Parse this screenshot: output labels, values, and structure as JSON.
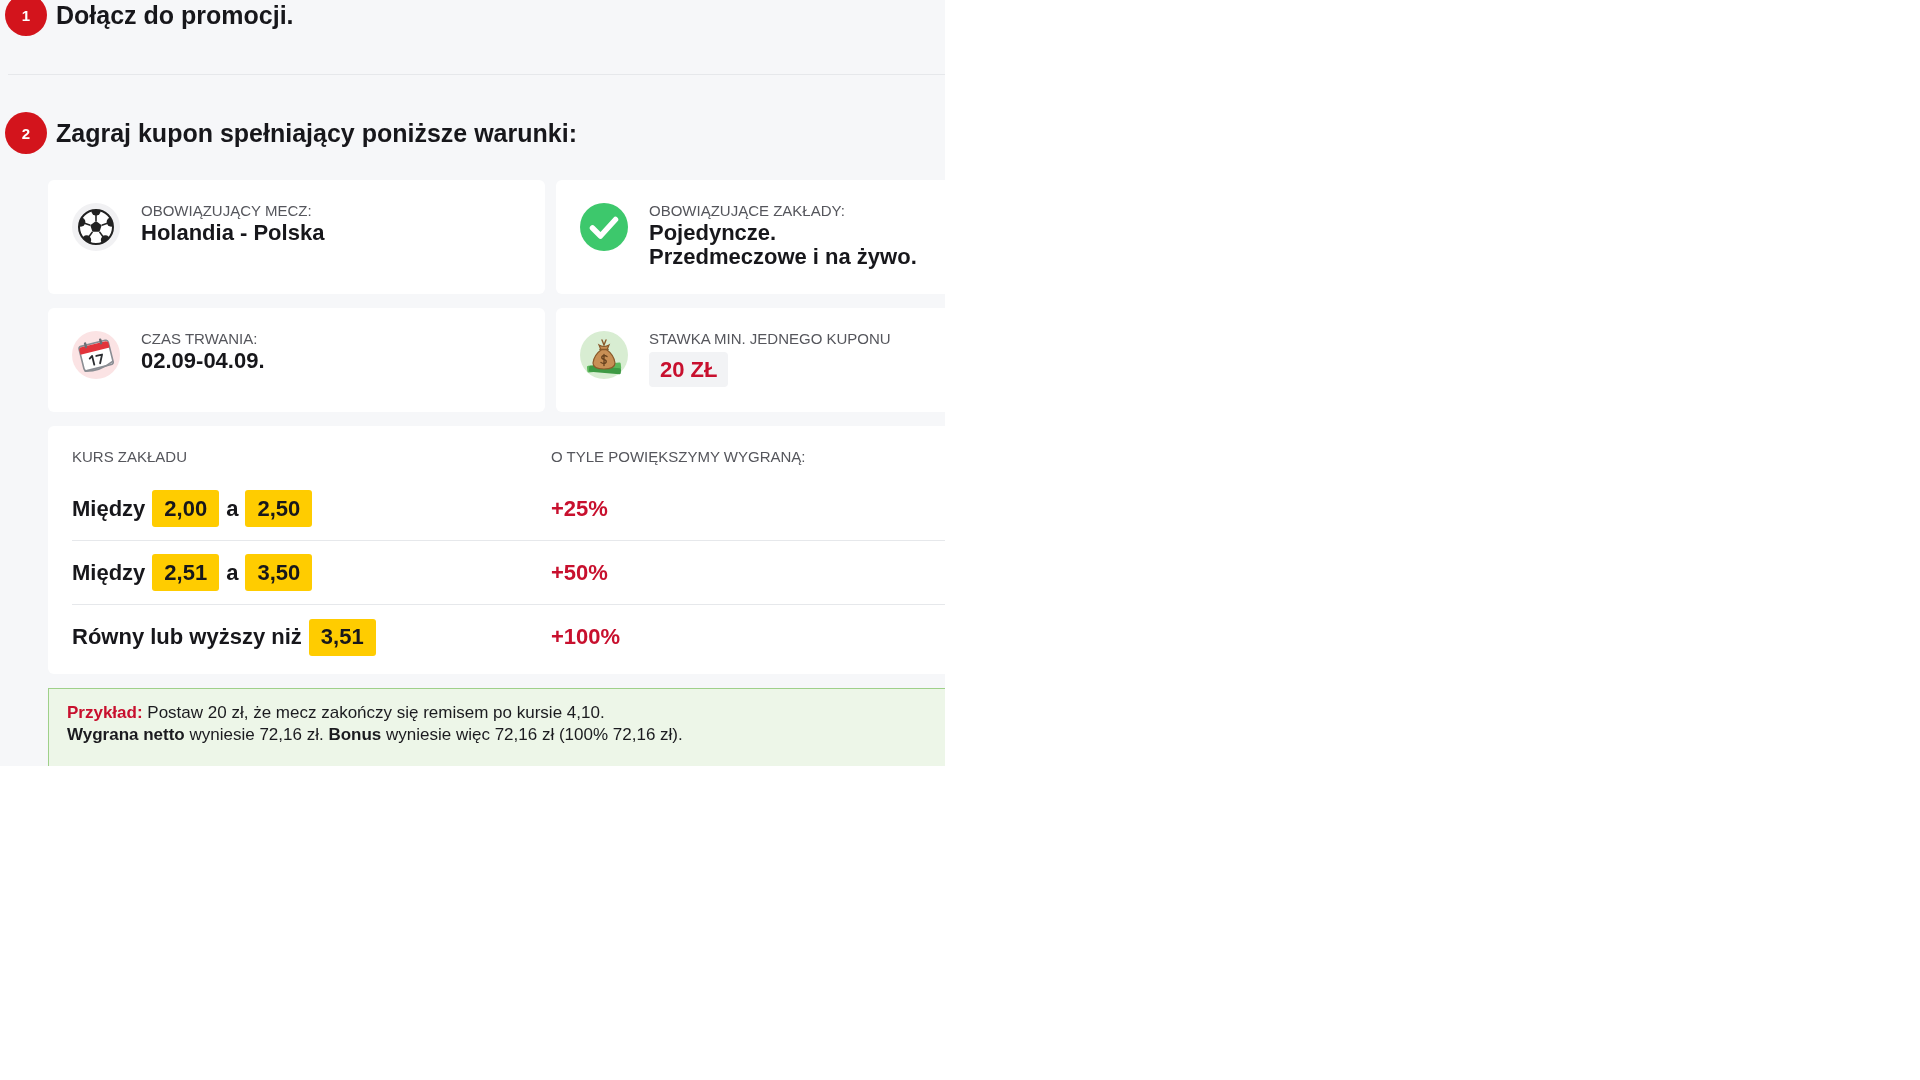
{
  "steps": [
    {
      "number": "1",
      "title": "Dołącz do promocji."
    },
    {
      "number": "2",
      "title": "Zagraj kupon spełniający poniższe warunki:"
    }
  ],
  "conditions": [
    {
      "kind": "ball",
      "label": "OBOWIĄZUJĄCY MECZ:",
      "lines": [
        "Holandia - Polska"
      ]
    },
    {
      "kind": "check",
      "label": "OBOWIĄZUJĄCE ZAKŁADY:",
      "lines": [
        "Pojedyncze.",
        "Przedmeczowe i na żywo."
      ]
    },
    {
      "kind": "calendar",
      "label": "CZAS TRWANIA:",
      "lines": [
        "02.09-04.09."
      ]
    },
    {
      "kind": "money",
      "label": "STAWKA MIN. JEDNEGO KUPONU",
      "amount": "20 ZŁ"
    }
  ],
  "odds_table": {
    "columns": [
      "KURS ZAKŁADU",
      "O TYLE POWIĘKSZYMY WYGRANĄ:"
    ],
    "rows": [
      {
        "range": [
          {
            "kind": "text",
            "text": "Między"
          },
          {
            "kind": "chip",
            "text": "2,00"
          },
          {
            "kind": "text",
            "text": "a"
          },
          {
            "kind": "chip",
            "text": "2,50"
          }
        ],
        "bonus": "+25%"
      },
      {
        "range": [
          {
            "kind": "text",
            "text": "Między"
          },
          {
            "kind": "chip",
            "text": "2,51"
          },
          {
            "kind": "text",
            "text": "a"
          },
          {
            "kind": "chip",
            "text": "3,50"
          }
        ],
        "bonus": "+50%"
      },
      {
        "range": [
          {
            "kind": "text",
            "text": "Równy lub wyższy niż"
          },
          {
            "kind": "chip",
            "text": "3,51"
          }
        ],
        "bonus": "+100%"
      }
    ]
  },
  "example": {
    "lead": "Przykład:",
    "lines": [
      "Postaw 20 zł, że mecz zakończy się remisem po kursie 4,10.",
      "**Wygrana netto** wyniesie 72,16 zł. **Bonus** wyniesie więc 72,16 zł (100% 72,16 zł)."
    ]
  }
}
